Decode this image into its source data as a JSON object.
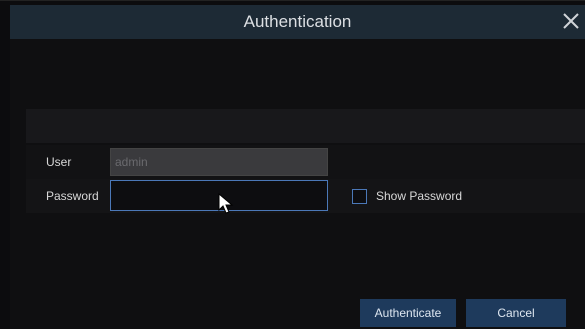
{
  "dialog": {
    "title": "Authentication",
    "close_icon": "close-icon"
  },
  "form": {
    "user_label": "User",
    "user_value": "admin",
    "password_label": "Password",
    "password_value": "",
    "show_password_label": "Show Password",
    "show_password_checked": false
  },
  "buttons": {
    "authenticate_label": "Authenticate",
    "cancel_label": "Cancel"
  },
  "colors": {
    "titlebar": "#1d2a35",
    "accent_border": "#4b78b8",
    "button": "#1e3a5c"
  }
}
